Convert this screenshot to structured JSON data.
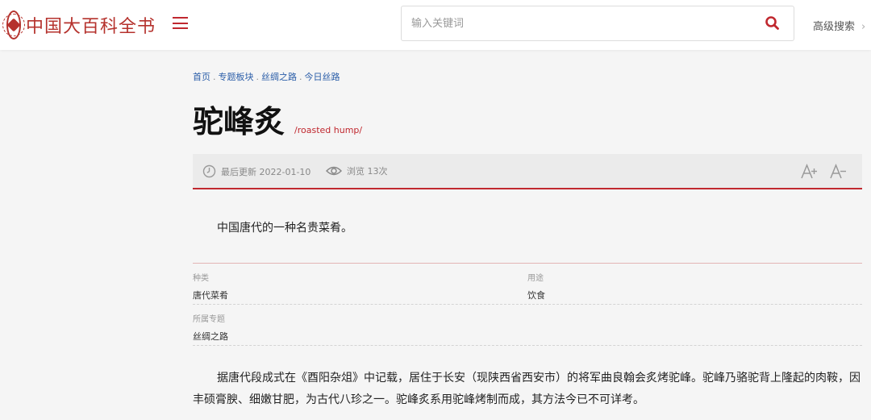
{
  "header": {
    "logo_text": "中国大百科全书",
    "search": {
      "placeholder": "输入关键词",
      "value": ""
    },
    "advanced_search_label": "高级搜索",
    "advanced_search_chevron": "›",
    "icons": {
      "menu": "hamburger-menu-icon",
      "search": "search-icon",
      "logo": "seal-logo-icon"
    }
  },
  "breadcrumb": {
    "items": [
      "首页",
      "专题板块",
      "丝绸之路",
      "今日丝路"
    ],
    "separator": "."
  },
  "article": {
    "title": "驼峰炙",
    "title_en": "/roasted hump/",
    "meta": {
      "updated": "最后更新 2022-01-10",
      "views": "浏览 13次",
      "icons": {
        "clock": "clock-icon",
        "eye": "eye-icon",
        "font_increase": "font-increase-icon",
        "font_decrease": "font-decrease-icon"
      }
    },
    "summary": "中国唐代的一种名贵菜肴。",
    "info": {
      "category_label": "种类",
      "category_value": "唐代菜肴",
      "usage_label": "用途",
      "usage_value": "饮食",
      "topic_label": "所属专题",
      "topic_value": "丝绸之路"
    },
    "body": "据唐代段成式在《酉阳杂俎》中记载，居住于长安（现陕西省西安市）的将军曲良翰会炙烤驼峰。驼峰乃骆驼背上隆起的肉鞍，因丰硕膏腴、细嫩甘肥，为古代八珍之一。驼峰炙系用驼峰烤制而成，其方法今已不可详考。"
  },
  "colors": {
    "accent": "#c0282f",
    "link": "#2a5da8",
    "meta_bar": "#ebebeb",
    "page_bg": "#f5f5f5"
  }
}
